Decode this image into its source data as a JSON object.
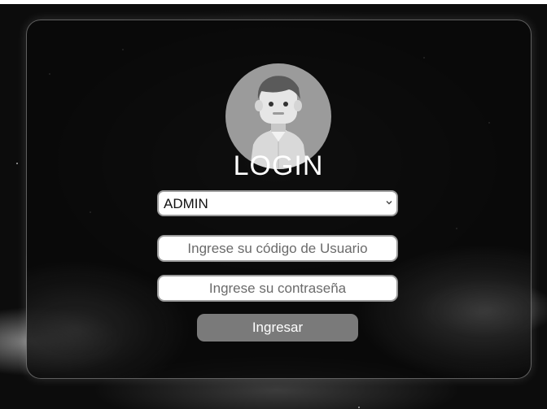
{
  "login": {
    "title": "LOGIN",
    "avatar_icon": "user-avatar-icon",
    "role_select": {
      "selected": "ADMIN",
      "icon": "chevron-down-icon"
    },
    "user_code": {
      "placeholder": "Ingrese su código de Usuario",
      "value": ""
    },
    "password": {
      "placeholder": "Ingrese su contraseña",
      "value": ""
    },
    "submit_label": "Ingresar"
  },
  "colors": {
    "background": "#0a0a0a",
    "panel": "#080808",
    "button": "#7a7a7a",
    "avatar_bg": "#9b9b9b",
    "text": "#ffffff"
  }
}
